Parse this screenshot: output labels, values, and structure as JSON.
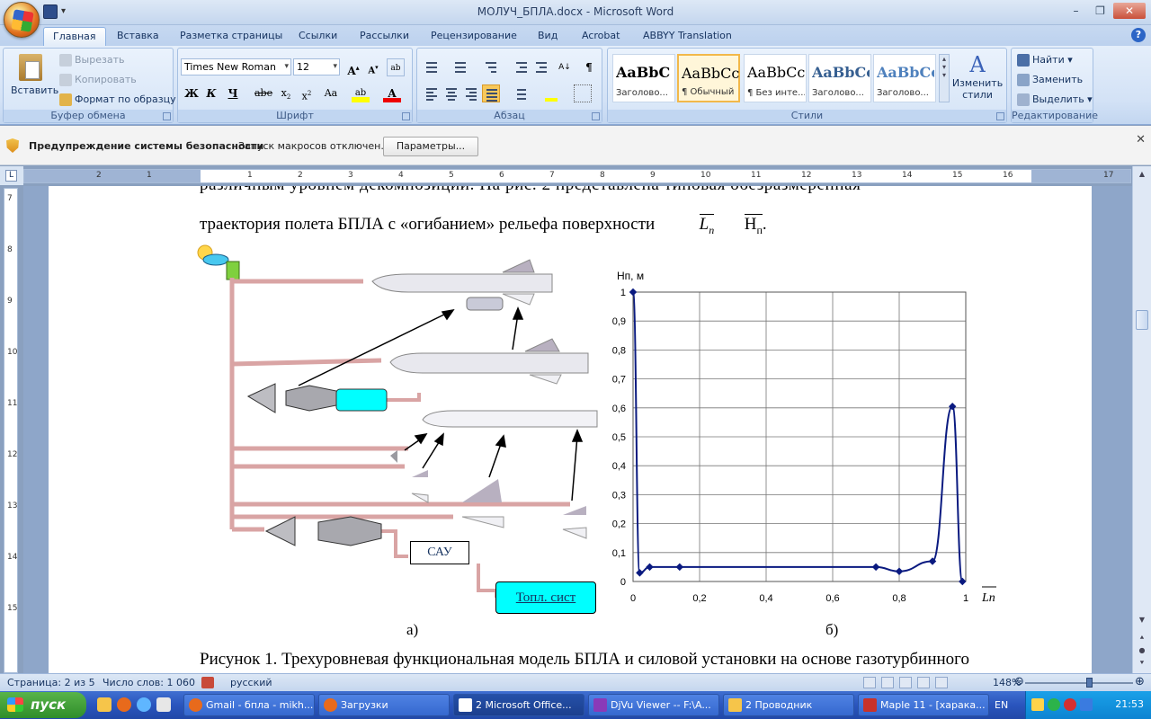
{
  "window": {
    "title": "МОЛУЧ_БПЛА.docx - Microsoft Word"
  },
  "tabs": [
    "Главная",
    "Вставка",
    "Разметка страницы",
    "Ссылки",
    "Рассылки",
    "Рецензирование",
    "Вид",
    "Acrobat",
    "ABBYY Translation"
  ],
  "ribbon": {
    "clipboard": {
      "label": "Буфер обмена",
      "paste": "Вставить",
      "cut": "Вырезать",
      "copy": "Копировать",
      "format_painter": "Формат по образцу"
    },
    "font": {
      "label": "Шрифт",
      "font_name": "Times New Roman",
      "font_size": "12"
    },
    "paragraph": {
      "label": "Абзац"
    },
    "styles": {
      "label": "Стили",
      "cards": [
        {
          "sample": "AaBbC",
          "name": "Заголово..."
        },
        {
          "sample": "AaBbCc",
          "name": "¶ Обычный"
        },
        {
          "sample": "AaBbCc",
          "name": "¶ Без инте..."
        },
        {
          "sample": "AaBbCc",
          "name": "Заголово..."
        },
        {
          "sample": "AaBbCc",
          "name": "Заголово..."
        }
      ],
      "change_styles": "Изменить",
      "change_styles2": "стили"
    },
    "editing": {
      "label": "Редактирование",
      "find": "Найти",
      "replace": "Заменить",
      "select": "Выделить"
    }
  },
  "security": {
    "title": "Предупреждение системы безопасности",
    "message": "Запуск макросов отключен.",
    "button": "Параметры..."
  },
  "document": {
    "line1": "различным уровнем декомпозиции. На рис. 2 представлена типовая обезразмеренная",
    "line2": "траектория полета БПЛА с «огибанием» рельефа поверхности",
    "symbol_l": "L",
    "symbol_l_sub": "п",
    "symbol_h": "H",
    "symbol_h_sub": "п",
    "period": ".",
    "fig_a_label": "а)",
    "fig_b_label": "б)",
    "sau_label": "САУ",
    "fuel_label": "Топл. сист",
    "caption": "Рисунок 1. Трехуровневая функциональная модель БПЛА и силовой установки на основе газотурбинного"
  },
  "chart_data": {
    "type": "line",
    "title": "",
    "ylabel": "Hп, м",
    "xlabel": "Lп",
    "xlim": [
      0,
      1
    ],
    "ylim": [
      0,
      1
    ],
    "xticks": [
      "0",
      "0,2",
      "0,4",
      "0,6",
      "0,8",
      "1"
    ],
    "yticks": [
      "0",
      "0,1",
      "0,2",
      "0,3",
      "0,4",
      "0,5",
      "0,6",
      "0,7",
      "0,8",
      "0,9",
      "1"
    ],
    "grid": true,
    "series": [
      {
        "color": "#0a1a80",
        "x": [
          0,
          0.02,
          0.05,
          0.14,
          0.73,
          0.8,
          0.9,
          0.96,
          0.99
        ],
        "y": [
          1,
          0.03,
          0.05,
          0.05,
          0.05,
          0.035,
          0.07,
          0.605,
          0
        ]
      }
    ]
  },
  "status": {
    "page": "Страница: 2 из 5",
    "words": "Число слов: 1 060",
    "lang": "русский",
    "zoom": "148%"
  },
  "taskbar": {
    "start": "пуск",
    "items": [
      "Gmail - бпла - mikh...",
      "Загрузки",
      "2 Microsoft Office...",
      "DjVu Viewer -- F:\\A...",
      "2 Проводник",
      "Maple 11 - [харака..."
    ],
    "lang": "EN",
    "clock": "21:53"
  },
  "colors": {
    "ribbon_bg": "#d3e2f6",
    "cyan_block": "#00ffff",
    "pink_line": "#d9a4a4"
  }
}
